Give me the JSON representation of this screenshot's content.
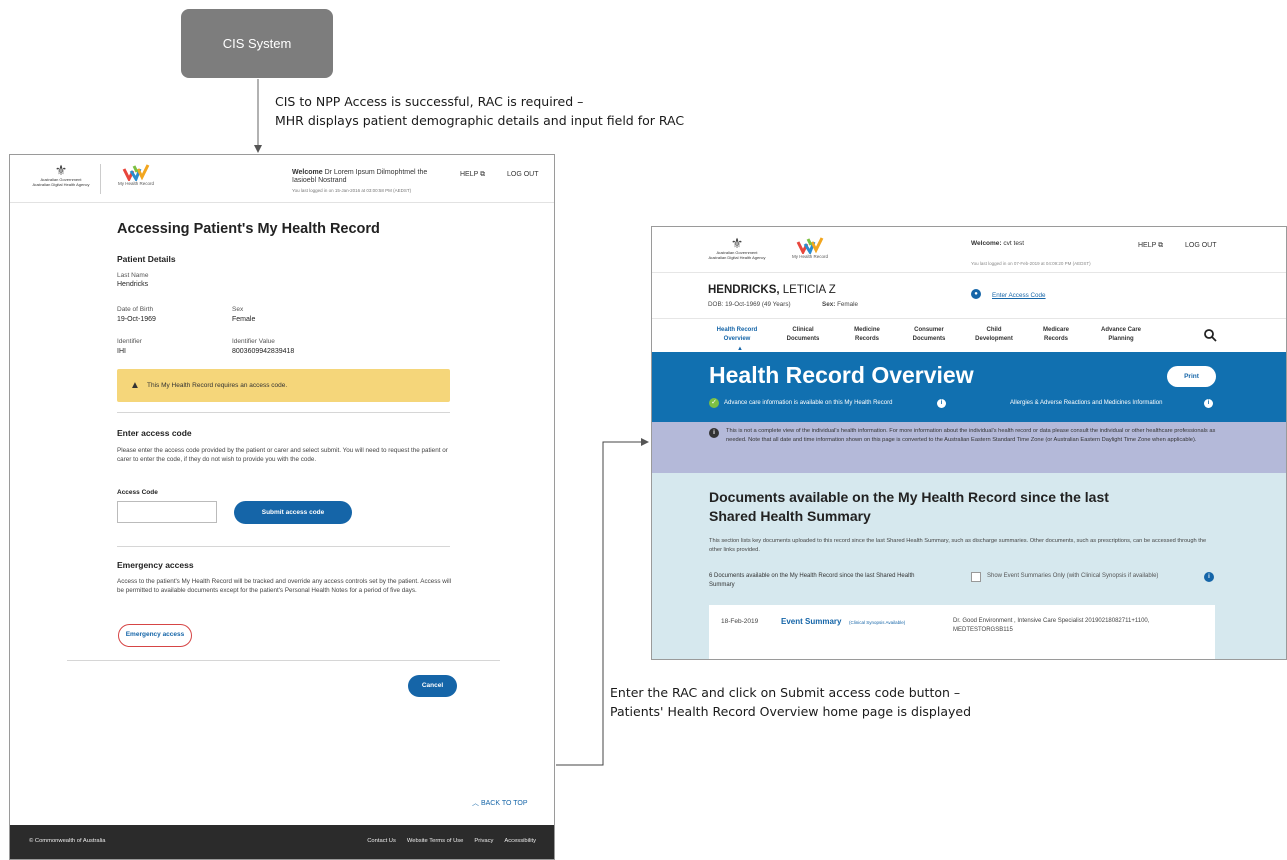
{
  "diagram": {
    "cis_box": "CIS System",
    "caption_top": [
      "CIS to NPP Access is successful, RAC is required –",
      "MHR displays patient demographic details and input field for RAC"
    ],
    "caption_bottom": [
      "Enter the RAC and click on Submit access code button –",
      "Patients' Health Record Overview home page is displayed"
    ]
  },
  "left_screen": {
    "header": {
      "gov_name": "Australian Government",
      "gov_agency": "Australian Digital Health Agency",
      "mhr_logo_text": "My Health Record",
      "welcome_label": "Welcome",
      "welcome_name": "Dr Lorem Ipsum Dilmophtmel the Iasioebl Nostrand",
      "last_logged": "You last logged in on 15-Jan-2016 at 03:00:58 PM (AEDST)",
      "help": "HELP",
      "logout": "LOG OUT"
    },
    "title": "Accessing Patient's My Health Record",
    "patient_details": {
      "heading": "Patient Details",
      "last_name_label": "Last Name",
      "last_name": "Hendricks",
      "dob_label": "Date of Birth",
      "dob": "19-Oct-1969",
      "sex_label": "Sex",
      "sex": "Female",
      "identifier_label": "Identifier",
      "identifier": "IHI",
      "identifier_value_label": "Identifier Value",
      "identifier_value": "8003609942839418"
    },
    "alert": "This My Health Record requires an access code.",
    "enter_code": {
      "heading": "Enter access code",
      "text": "Please enter the access code provided by the patient or carer and select submit. You will need to request the patient or carer to enter the code, if they do not wish to provide you with the code.",
      "field_label": "Access Code",
      "field_value": "",
      "submit": "Submit access code"
    },
    "emergency": {
      "heading": "Emergency access",
      "text": "Access to the patient's My Health Record will be tracked and override any access controls set by the patient. Access will be permitted to available documents except for the patient's Personal Health Notes for a period of five days.",
      "button": "Emergency access"
    },
    "cancel": "Cancel",
    "back_to_top": "BACK TO TOP",
    "footer": {
      "copyright": "© Commonwealth of Australia",
      "links": [
        "Contact Us",
        "Website Terms of Use",
        "Privacy",
        "Accessibility"
      ]
    }
  },
  "right_screen": {
    "header": {
      "gov_name": "Australian Government",
      "gov_agency": "Australian Digital Health Agency",
      "mhr_logo_text": "My Health Record",
      "welcome_label": "Welcome:",
      "welcome_name": "cvt test",
      "last_logged": "You last logged in on 07-Feb-2019 at 04:09:20 PM (AEDST)",
      "help": "HELP",
      "logout": "LOG OUT"
    },
    "patient": {
      "surname": "HENDRICKS,",
      "given": "LETICIA Z",
      "dob": "DOB: 19-Oct-1969 (49 Years)",
      "sex_label": "Sex:",
      "sex": "Female",
      "access_link": "Enter Access Code"
    },
    "nav": [
      {
        "l1": "Health Record",
        "l2": "Overview",
        "active": true
      },
      {
        "l1": "Clinical",
        "l2": "Documents"
      },
      {
        "l1": "Medicine",
        "l2": "Records"
      },
      {
        "l1": "Consumer",
        "l2": "Documents"
      },
      {
        "l1": "Child",
        "l2": "Development"
      },
      {
        "l1": "Medicare",
        "l2": "Records"
      },
      {
        "l1": "Advance Care",
        "l2": "Planning"
      }
    ],
    "overview": {
      "title": "Health Record Overview",
      "print": "Print",
      "acp": "Advance care information is available on this My Health Record",
      "allergies": "Allergies & Adverse Reactions and Medicines Information"
    },
    "notice": "This is not a complete view of the individual's health information. For more information about the individual's health record or data please consult the individual or other healthcare professionals as needed. Note that all date and time information shown on this page is converted to the Australian Eastern Standard Time Zone (or Australian Eastern Daylight Time Zone when applicable).",
    "documents": {
      "title": "Documents available on the My Health Record since the last Shared Health Summary",
      "desc": "This section lists key documents uploaded to this record since the last Shared Health Summary, such as discharge summaries. Other documents, such as prescriptions, can be accessed through the other links provided.",
      "count": "6 Documents available on the My Health Record since the last Shared Health Summary",
      "checkbox_label": "Show Event Summaries Only (with Clinical Synopsis if available)",
      "row": {
        "date": "18-Feb-2019",
        "type": "Event Summary",
        "synopsis": "(Clinical Synopsis Available)",
        "author": "Dr. Good Environment , Intensive Care Specialist 20190218082711+1100, MEDTESTORGSB115"
      }
    }
  },
  "colors": {
    "primary_blue": "#1565a8",
    "overview_band": "#1170b0",
    "alert_yellow": "#f5d67a",
    "notice_purple": "#b4b9d9",
    "docs_bg": "#d6e8ee",
    "footer_dark": "#2b2b2b",
    "cis_grey": "#7d7d7d"
  }
}
